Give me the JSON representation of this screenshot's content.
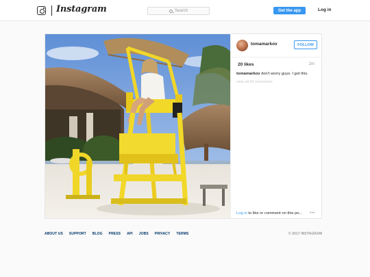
{
  "header": {
    "wordmark": "Instagram",
    "search_placeholder": "Search",
    "get_app_label": "Get the app",
    "login_label": "Log in",
    "accent_color": "#3897f0"
  },
  "post": {
    "username": "tomamarkov",
    "follow_label": "FOLLOW",
    "likes": "20 likes",
    "time_ago": "2m",
    "caption_user": "tomamarkov",
    "caption_text": " don't worry guys. I got this.",
    "view_all_comments": "view all 20 comments",
    "login_link": "Log in",
    "login_suffix": " to like or comment on this po...",
    "more_icon": "•••",
    "photo_alt": "photo"
  },
  "footer": {
    "links": [
      "ABOUT US",
      "SUPPORT",
      "BLOG",
      "PRESS",
      "API",
      "JOBS",
      "PRIVACY",
      "TERMS"
    ],
    "copyright": "© 2017 INSTAGRAM"
  }
}
